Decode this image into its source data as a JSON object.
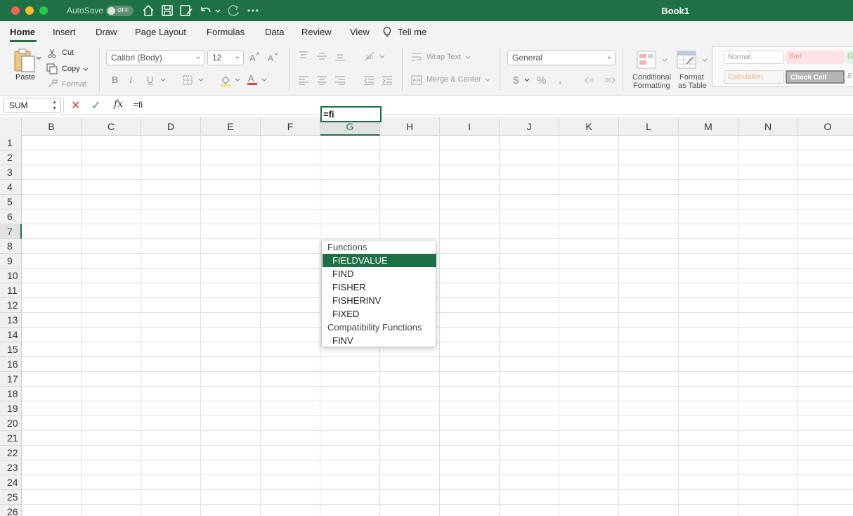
{
  "titlebar": {
    "autosave_label": "AutoSave",
    "autosave_state": "OFF",
    "doc_title": "Book1"
  },
  "menu": {
    "tabs": [
      "Home",
      "Insert",
      "Draw",
      "Page Layout",
      "Formulas",
      "Data",
      "Review",
      "View",
      "Tell me"
    ],
    "active": "Home"
  },
  "ribbon": {
    "paste": "Paste",
    "cut": "Cut",
    "copy": "Copy",
    "format": "Format",
    "font_name": "Calibri (Body)",
    "font_size": "12",
    "bold": "B",
    "italic": "I",
    "underline": "U",
    "wrap_text": "Wrap Text",
    "merge_center": "Merge & Center",
    "number_format": "General",
    "conditional_formatting_1": "Conditional",
    "conditional_formatting_2": "Formatting",
    "format_as_table_1": "Format",
    "format_as_table_2": "as Table",
    "styles": {
      "normal": "Normal",
      "bad": "Bad",
      "good": "G",
      "calculation": "Calculation",
      "check_cell": "Check Cell",
      "explanatory": "E"
    }
  },
  "formula_bar": {
    "name_box": "SUM",
    "content": "=fi"
  },
  "grid": {
    "columns": [
      "B",
      "C",
      "D",
      "E",
      "F",
      "G",
      "H",
      "I",
      "J",
      "K",
      "L",
      "M",
      "N",
      "O"
    ],
    "rows": [
      "1",
      "2",
      "3",
      "4",
      "5",
      "6",
      "7",
      "8",
      "9",
      "10",
      "11",
      "12",
      "13",
      "14",
      "15",
      "16",
      "17",
      "18",
      "19",
      "20",
      "21",
      "22",
      "23",
      "24",
      "25",
      "26"
    ],
    "selected_column": "G",
    "selected_row": "7",
    "active_cell_value": "=fi"
  },
  "autocomplete": {
    "section_functions": "Functions",
    "functions": [
      "FIELDVALUE",
      "FIND",
      "FISHER",
      "FISHERINV",
      "FIXED"
    ],
    "selected": "FIELDVALUE",
    "section_compat": "Compatibility Functions",
    "compat_functions": [
      "FINV"
    ]
  },
  "colors": {
    "accent": "#1e7145",
    "cancel": "#d63b3b",
    "confirm": "#2e9e50"
  }
}
